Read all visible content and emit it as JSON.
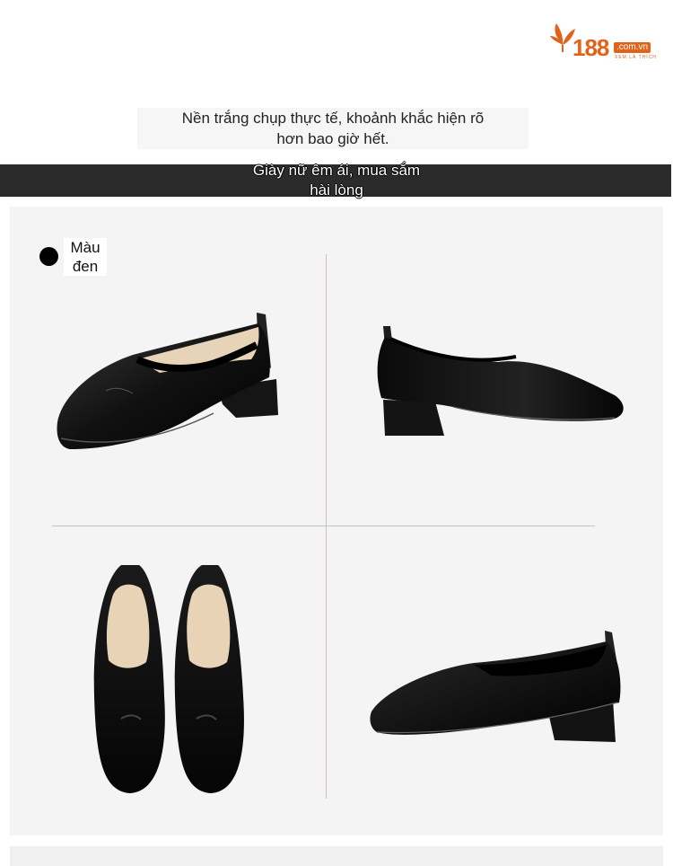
{
  "brand": {
    "number": "188",
    "domain": ".com.vn",
    "tagline": "XEM LÀ THÍCH",
    "accent_color": "#e2621a"
  },
  "headline": {
    "line1": "Nền trắng chụp thực tế, khoảnh khắc hiện rõ",
    "line2": "hơn bao giờ hết."
  },
  "banner": {
    "line1": "Giày nữ êm ái, mua sắm",
    "line2": "hài lòng"
  },
  "product": {
    "color_label_line1": "Màu",
    "color_label_line2": "đen",
    "color_swatch": "#000000",
    "views": [
      "front-left-view",
      "side-right-view",
      "top-pair-view",
      "back-right-view"
    ]
  }
}
